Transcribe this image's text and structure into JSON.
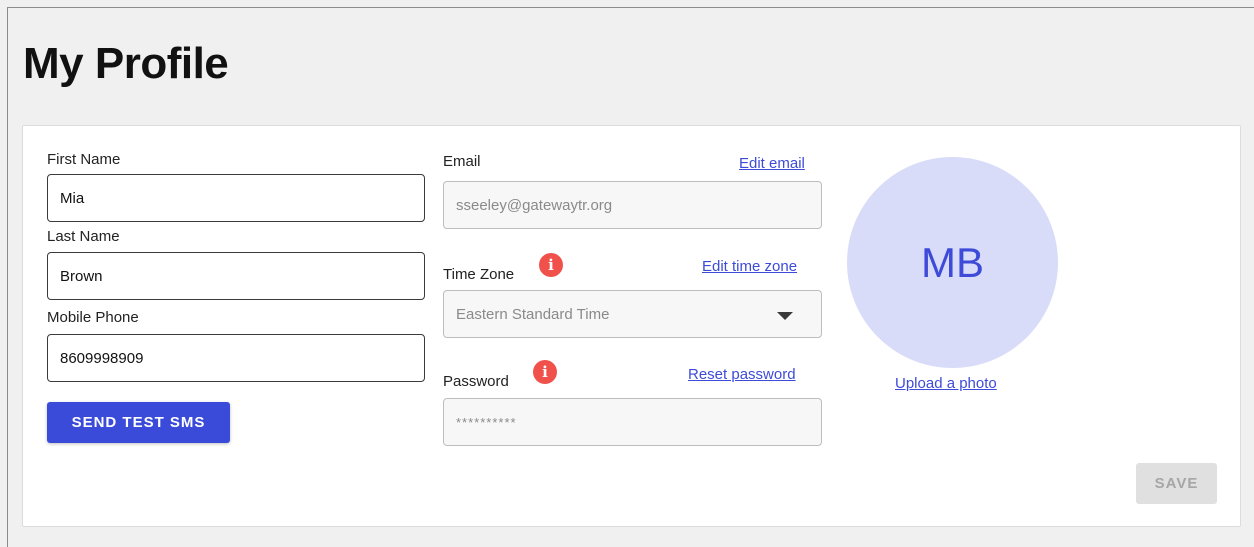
{
  "page": {
    "title": "My Profile"
  },
  "profile": {
    "first_name": {
      "label": "First Name",
      "value": "Mia"
    },
    "last_name": {
      "label": "Last Name",
      "value": "Brown"
    },
    "mobile_phone": {
      "label": "Mobile Phone",
      "value": "8609998909"
    },
    "send_test_sms_label": "SEND TEST SMS",
    "email": {
      "label": "Email",
      "value": "sseeley@gatewaytr.org",
      "edit_link": "Edit email"
    },
    "time_zone": {
      "label": "Time Zone",
      "value": "Eastern Standard Time",
      "edit_link": "Edit time zone"
    },
    "password": {
      "label": "Password",
      "value": "**********",
      "reset_link": "Reset password"
    },
    "info_icon_glyph": "i",
    "avatar": {
      "initials": "MB",
      "upload_link": "Upload a photo"
    },
    "save_label": "SAVE"
  },
  "colors": {
    "accent": "#3a4ad9",
    "link": "#3d4bd8",
    "info": "#f0514b",
    "avatar_bg": "#d9dcf8",
    "disabled_button_bg": "#e0e0e0"
  },
  "icons": {
    "info": "info-icon",
    "dropdown": "chevron-down-icon"
  }
}
